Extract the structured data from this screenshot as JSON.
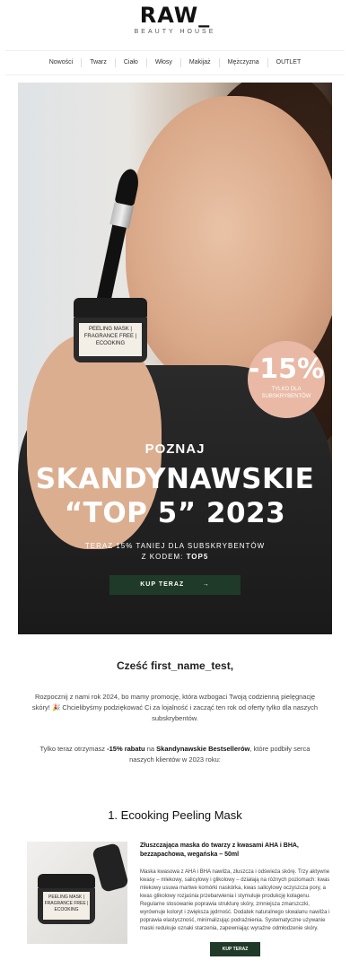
{
  "brand": {
    "name": "RAW_",
    "tagline": "BEAUTY HOUSE"
  },
  "nav": [
    "Nowości",
    "Twarz",
    "Ciało",
    "Włosy",
    "Makijaż",
    "Mężczyzna",
    "OUTLET"
  ],
  "hero": {
    "jar_label": "PEELING MASK | FRAGRANCE FREE | ECOOKING",
    "badge_big": "-15%",
    "badge_small": "TYLKO DLA SUBSKRYBENTÓW",
    "subtitle": "POZNAJ",
    "title_line1": "SKANDYNAWSKIE",
    "title_line2": "“TOP 5” 2023",
    "promo_line1": "TERAZ 15% TANIEJ DLA SUBSKRYBENTÓW",
    "promo_line2_prefix": "Z KODEM: ",
    "promo_code": "TOP5",
    "cta_label": "KUP TERAZ",
    "cta_arrow": "→"
  },
  "greeting": "Cześć first_name_test,",
  "para1": "Rozpocznij z nami rok 2024, bo mamy promocję, która wzbogaci Twoją codzienną pielęgnację skóry! 🎉 Chcielibyśmy podziękować Ci za lojalność i zacząć ten rok od oferty tylko dla naszych subskrybentów.",
  "para2": {
    "part1": "Tylko teraz otrzymasz ",
    "bold1": "-15% rabatu",
    "part2": " na ",
    "bold2": "Skandynawskie Bestsellerów",
    "part3": ", które podbiły serca naszych klientów w 2023 roku:"
  },
  "product": {
    "title": "1. Ecooking Peeling Mask",
    "jar_label": "PEELING MASK | FRAGRANCE FREE | ECOOKING",
    "headline": "Złuszczająca maska do twarzy z kwasami AHA i BHA, bezzapachowa, wegańska – 50ml",
    "description": "Maska kwasowa z AHA i BHA nawilża, złuszcza i odświeża skórę. Trzy aktywne kwasy – mlekowy, salicylowy i glikolowy – działają na różnych poziomach: kwas mlekowy usuwa martwe komórki naskórka, kwas salicylowy oczyszcza pory, a kwas glikolowy rozjaśnia przebarwienia i stymuluje produkcję kolagenu. Regularne stosowanie poprawia strukturę skóry, zmniejsza zmarszczki, wyrównuje koloryt i zwiększa jędrność. Dodatek naturalnego skwalanu nawilża i poprawia elastyczność, minimalizując podrażnienia. Systematyczne używanie maski redukuje oznaki starzenia, zapewniając wyraźne odmłodzenie skóry.",
    "button_label": "KUP TERAZ"
  }
}
